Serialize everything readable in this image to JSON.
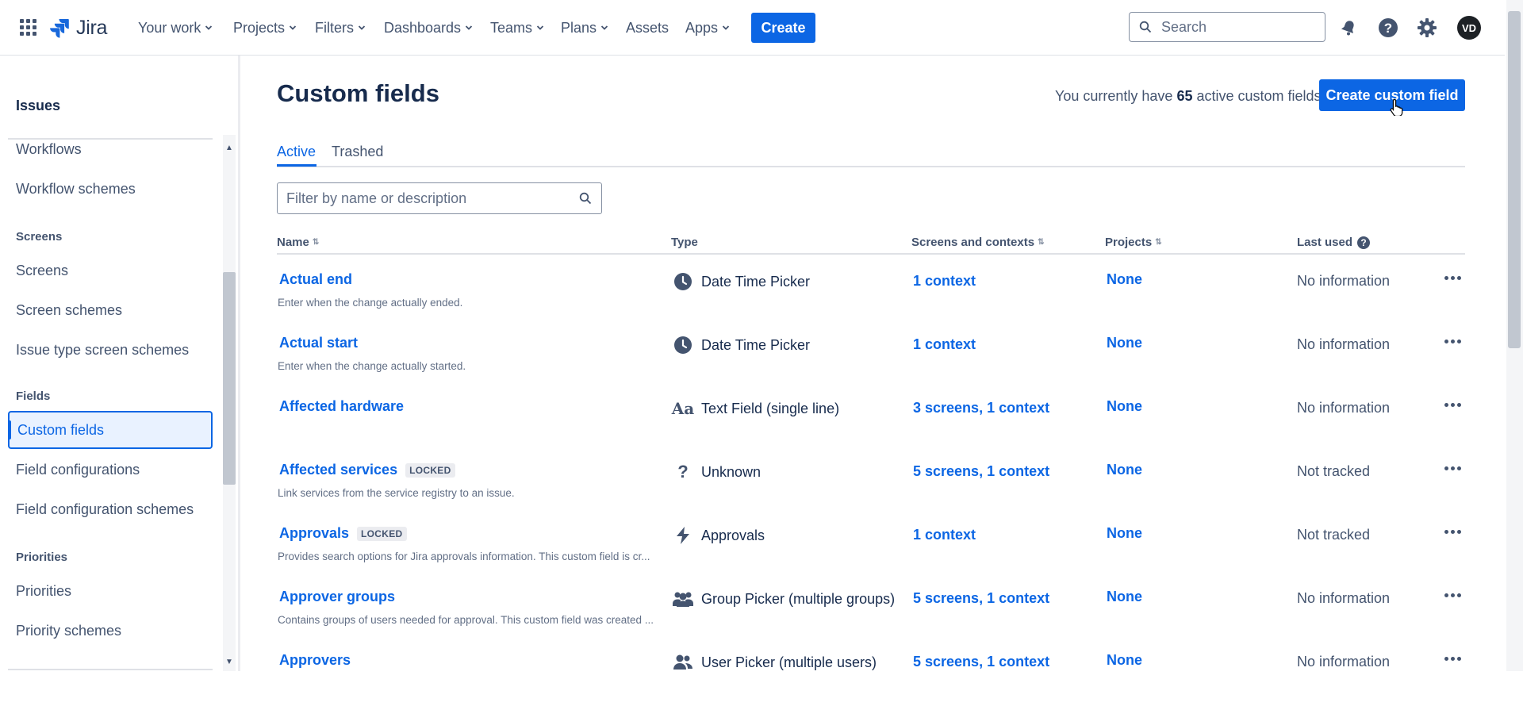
{
  "topnav": {
    "product": "Jira",
    "items": [
      {
        "label": "Your work",
        "has_menu": true
      },
      {
        "label": "Projects",
        "has_menu": true
      },
      {
        "label": "Filters",
        "has_menu": true
      },
      {
        "label": "Dashboards",
        "has_menu": true
      },
      {
        "label": "Teams",
        "has_menu": true
      },
      {
        "label": "Plans",
        "has_menu": true
      },
      {
        "label": "Assets",
        "has_menu": false
      },
      {
        "label": "Apps",
        "has_menu": true
      }
    ],
    "create_label": "Create",
    "search_placeholder": "Search",
    "avatar_initials": "VD",
    "accent": "#0c66e4"
  },
  "sidebar": {
    "heading": "Issues",
    "workflows": "Workflows",
    "workflow_schemes": "Workflow schemes",
    "screens_section": "Screens",
    "screens": "Screens",
    "screen_schemes": "Screen schemes",
    "issue_type_screen_schemes": "Issue type screen schemes",
    "fields_section": "Fields",
    "custom_fields": "Custom fields",
    "field_configurations": "Field configurations",
    "field_configuration_schemes": "Field configuration schemes",
    "priorities_section": "Priorities",
    "priorities": "Priorities",
    "priority_schemes": "Priority schemes"
  },
  "main": {
    "title": "Custom fields",
    "summary_prefix": "You currently have",
    "summary_count": "65",
    "summary_suffix": "active custom fields",
    "create_button": "Create custom field",
    "tabs": [
      {
        "label": "Active",
        "active": true
      },
      {
        "label": "Trashed",
        "active": false
      }
    ],
    "filter_placeholder": "Filter by name or description",
    "columns": {
      "name": "Name",
      "type": "Type",
      "screens": "Screens and contexts",
      "projects": "Projects",
      "last_used": "Last used"
    },
    "rows": [
      {
        "name": "Actual end",
        "locked": false,
        "description": "Enter when the change actually ended.",
        "type": "Date Time Picker",
        "type_icon": "clock-icon",
        "contexts": "1 context",
        "projects": "None",
        "last_used": "No information"
      },
      {
        "name": "Actual start",
        "locked": false,
        "description": "Enter when the change actually started.",
        "type": "Date Time Picker",
        "type_icon": "clock-icon",
        "contexts": "1 context",
        "projects": "None",
        "last_used": "No information"
      },
      {
        "name": "Affected hardware",
        "locked": false,
        "description": "",
        "type": "Text Field (single line)",
        "type_icon": "text-icon",
        "contexts": "3 screens,  1 context",
        "projects": "None",
        "last_used": "No information"
      },
      {
        "name": "Affected services",
        "locked": true,
        "description": "Link services from the service registry to an issue.",
        "type": "Unknown",
        "type_icon": "question-icon",
        "contexts": "5 screens,  1 context",
        "projects": "None",
        "last_used": "Not tracked"
      },
      {
        "name": "Approvals",
        "locked": true,
        "description": "Provides search options for Jira approvals information. This custom field is cr...",
        "type": "Approvals",
        "type_icon": "lightning-icon",
        "contexts": "1 context",
        "projects": "None",
        "last_used": "Not tracked"
      },
      {
        "name": "Approver groups",
        "locked": false,
        "description": "Contains groups of users needed for approval. This custom field was created ...",
        "type": "Group Picker (multiple groups)",
        "type_icon": "group-icon",
        "contexts": "5 screens,  1 context",
        "projects": "None",
        "last_used": "No information"
      },
      {
        "name": "Approvers",
        "locked": false,
        "description": "",
        "type": "User Picker (multiple users)",
        "type_icon": "users-icon",
        "contexts": "5 screens,  1 context",
        "projects": "None",
        "last_used": "No information"
      }
    ],
    "locked_label": "LOCKED"
  }
}
